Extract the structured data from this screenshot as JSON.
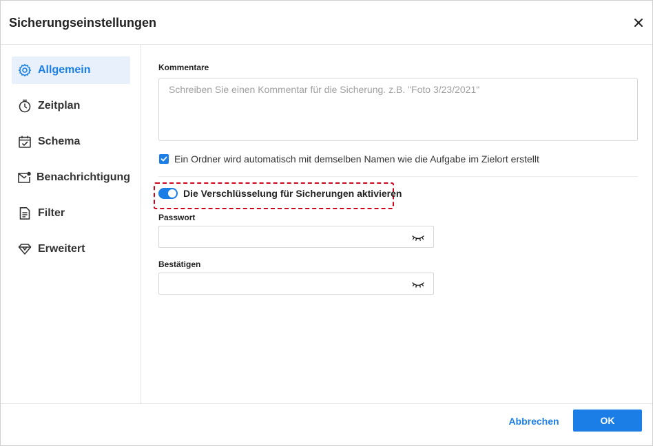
{
  "dialog": {
    "title": "Sicherungseinstellungen"
  },
  "sidebar": {
    "items": [
      {
        "label": "Allgemein",
        "icon": "gear-icon",
        "active": true
      },
      {
        "label": "Zeitplan",
        "icon": "timer-icon",
        "active": false
      },
      {
        "label": "Schema",
        "icon": "calendar-check-icon",
        "active": false
      },
      {
        "label": "Benachrichtigung",
        "icon": "mail-icon",
        "active": false
      },
      {
        "label": "Filter",
        "icon": "document-icon",
        "active": false
      },
      {
        "label": "Erweitert",
        "icon": "diamond-icon",
        "active": false
      }
    ]
  },
  "main": {
    "comments_label": "Kommentare",
    "comments_placeholder": "Schreiben Sie einen Kommentar für die Sicherung. z.B. \"Foto 3/23/2021\"",
    "comments_value": "",
    "auto_folder_checked": true,
    "auto_folder_text": "Ein Ordner wird automatisch mit demselben Namen wie die Aufgabe im Zielort erstellt",
    "encryption_enabled": true,
    "encryption_text": "Die Verschlüsselung für Sicherungen aktivieren",
    "password_label": "Passwort",
    "password_value": "",
    "confirm_label": "Bestätigen",
    "confirm_value": ""
  },
  "footer": {
    "cancel_label": "Abbrechen",
    "ok_label": "OK"
  },
  "colors": {
    "accent": "#1a7ee6",
    "highlight": "#d0021b",
    "active_bg": "#e8f1fb"
  }
}
